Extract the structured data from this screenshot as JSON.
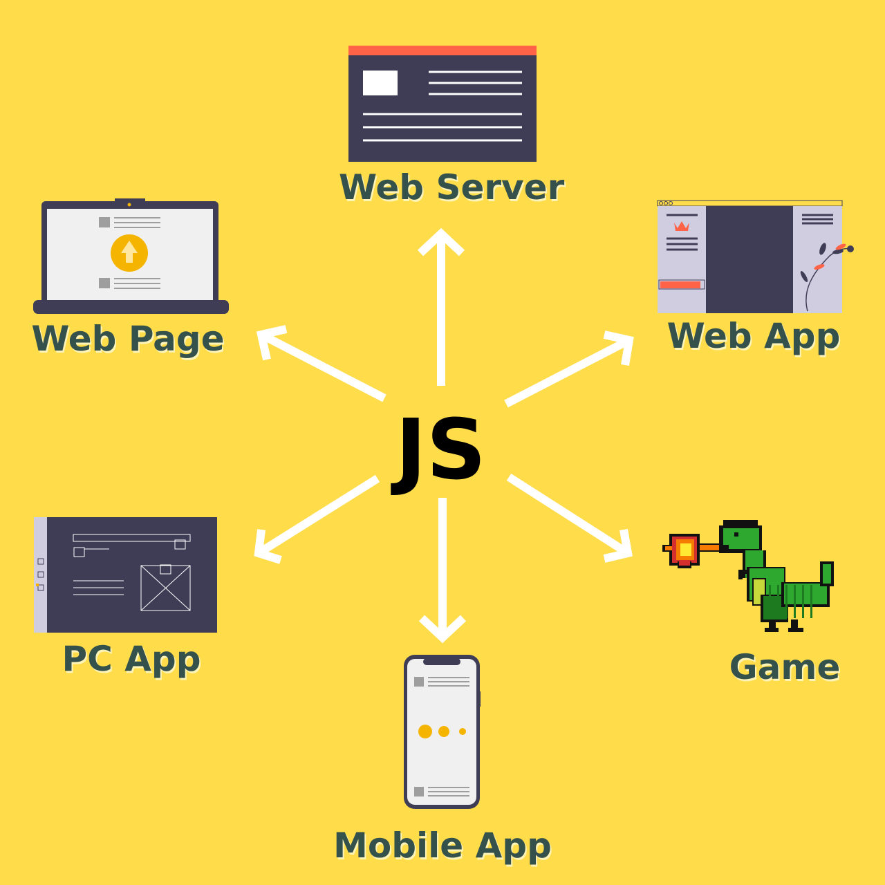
{
  "center": {
    "label": "JS"
  },
  "nodes": {
    "web_server": {
      "label": "Web Server",
      "icon": "server-window-icon"
    },
    "web_page": {
      "label": "Web Page",
      "icon": "laptop-icon"
    },
    "web_app": {
      "label": "Web App",
      "icon": "browser-app-icon"
    },
    "pc_app": {
      "label": "PC App",
      "icon": "desktop-window-icon"
    },
    "game": {
      "label": "Game",
      "icon": "pixel-dinosaur-icon"
    },
    "mobile_app": {
      "label": "Mobile App",
      "icon": "smartphone-icon"
    }
  },
  "colors": {
    "background": "#FEDC4A",
    "label": "#35514C",
    "arrow": "#FFFFFF",
    "dark": "#3F3D56",
    "accent_red": "#FF6347",
    "accent_yellow": "#F4B400"
  }
}
